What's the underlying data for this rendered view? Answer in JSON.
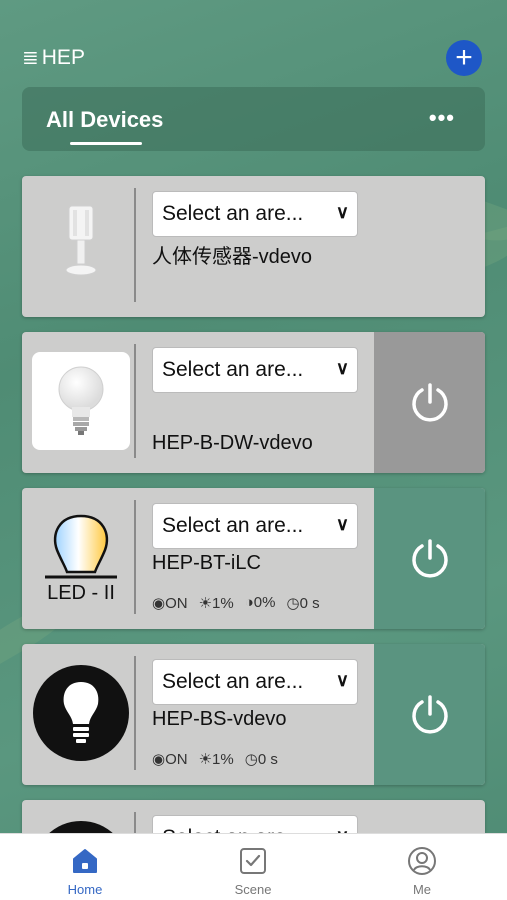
{
  "header": {
    "brand": "HEP",
    "menu_glyph": "≣",
    "add_glyph": "+"
  },
  "tabs": {
    "active_label": "All Devices",
    "more_glyph": "•••"
  },
  "devices": [
    {
      "area_placeholder": "Select an are...",
      "name": "人体传感器-vdevo",
      "icon": "motion-sensor-icon"
    },
    {
      "area_placeholder": "Select an are...",
      "name": "HEP-B-DW-vdevo",
      "icon": "light-bulb-icon",
      "power_state": "offline"
    },
    {
      "area_placeholder": "Select an are...",
      "name": "HEP-BT-iLC",
      "icon": "led-ii-icon",
      "image_label": "LED - II",
      "status": {
        "on": "ON",
        "brightness": "1%",
        "color_temp": "0%",
        "timer": "0 s"
      }
    },
    {
      "area_placeholder": "Select an are...",
      "name": "HEP-BS-vdevo",
      "icon": "light-bulb-icon",
      "status": {
        "on": "ON",
        "brightness": "1%",
        "timer": "0 s"
      }
    },
    {
      "area_placeholder": "Select an are..."
    }
  ],
  "nav": {
    "home": "Home",
    "scene": "Scene",
    "me": "Me"
  },
  "colors": {
    "accent": "#1e57c7",
    "nav_active": "#3568c4",
    "power_on_bg": "#5a9480",
    "power_off_bg": "#999999",
    "background": "#5a977f"
  }
}
